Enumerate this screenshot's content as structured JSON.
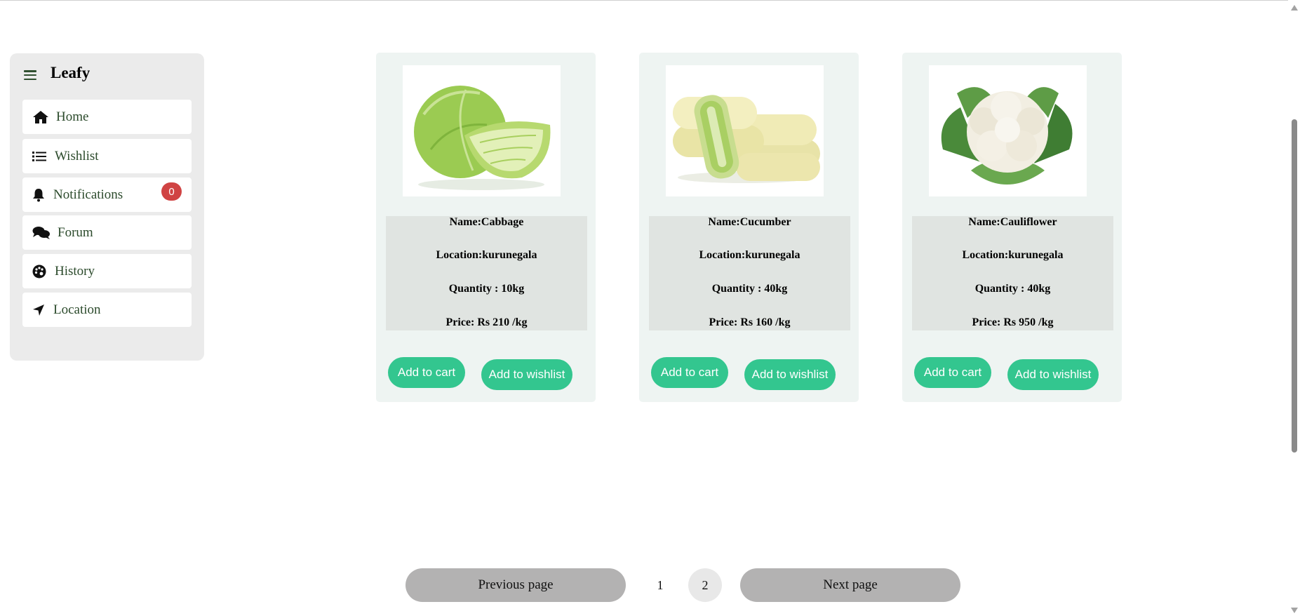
{
  "app": {
    "brand": "Leafy"
  },
  "sidebar": {
    "items": [
      {
        "label": "Home",
        "icon": "home-icon"
      },
      {
        "label": "Wishlist",
        "icon": "list-icon"
      },
      {
        "label": "Notifications",
        "icon": "bell-icon",
        "badge": "0"
      },
      {
        "label": "Forum",
        "icon": "comments-icon"
      },
      {
        "label": "History",
        "icon": "palette-icon"
      },
      {
        "label": "Location",
        "icon": "location-arrow-icon"
      }
    ]
  },
  "products": [
    {
      "name": "Name:Cabbage",
      "location": "Location:kurunegala",
      "quantity": "Quantity : 10kg",
      "price": "Price: Rs 210 /kg",
      "image": "cabbage-image",
      "cart_label": "Add to cart",
      "wishlist_label": "Add to wishlist"
    },
    {
      "name": "Name:Cucumber",
      "location": "Location:kurunegala",
      "quantity": "Quantity : 40kg",
      "price": "Price: Rs 160 /kg",
      "image": "cucumber-image",
      "cart_label": "Add to cart",
      "wishlist_label": "Add to wishlist"
    },
    {
      "name": "Name:Cauliflower",
      "location": "Location:kurunegala",
      "quantity": "Quantity : 40kg",
      "price": "Price: Rs 950 /kg",
      "image": "cauliflower-image",
      "cart_label": "Add to cart",
      "wishlist_label": "Add to wishlist"
    }
  ],
  "pagination": {
    "prev_label": "Previous page",
    "next_label": "Next page",
    "pages": [
      "1",
      "2"
    ],
    "current_page": "2"
  },
  "colors": {
    "accent": "#33c68f",
    "badge": "#d04343",
    "pager": "#b3b2b2"
  }
}
